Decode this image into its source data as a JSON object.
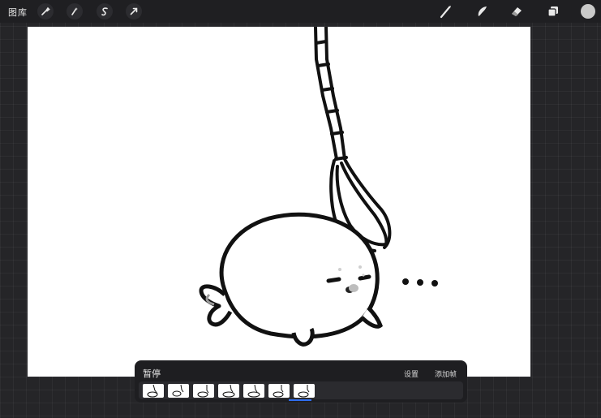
{
  "topbar": {
    "gallery_label": "图库",
    "left_tools": [
      {
        "name": "wrench-icon"
      },
      {
        "name": "magic-wand-icon"
      },
      {
        "name": "selection-s-icon"
      },
      {
        "name": "transform-arrow-icon"
      }
    ],
    "right_tools": [
      {
        "name": "brush-icon"
      },
      {
        "name": "smudge-icon"
      },
      {
        "name": "eraser-icon"
      },
      {
        "name": "layers-icon"
      }
    ],
    "current_color": "#c9c9c9"
  },
  "canvas": {
    "background": "#ffffff",
    "dots_text": "..."
  },
  "animation": {
    "title": "暂停",
    "settings_label": "设置",
    "add_frame_label": "添加帧",
    "frame_count": 7,
    "selected_frame": 7,
    "indicator_color": "#2f6ef0"
  }
}
